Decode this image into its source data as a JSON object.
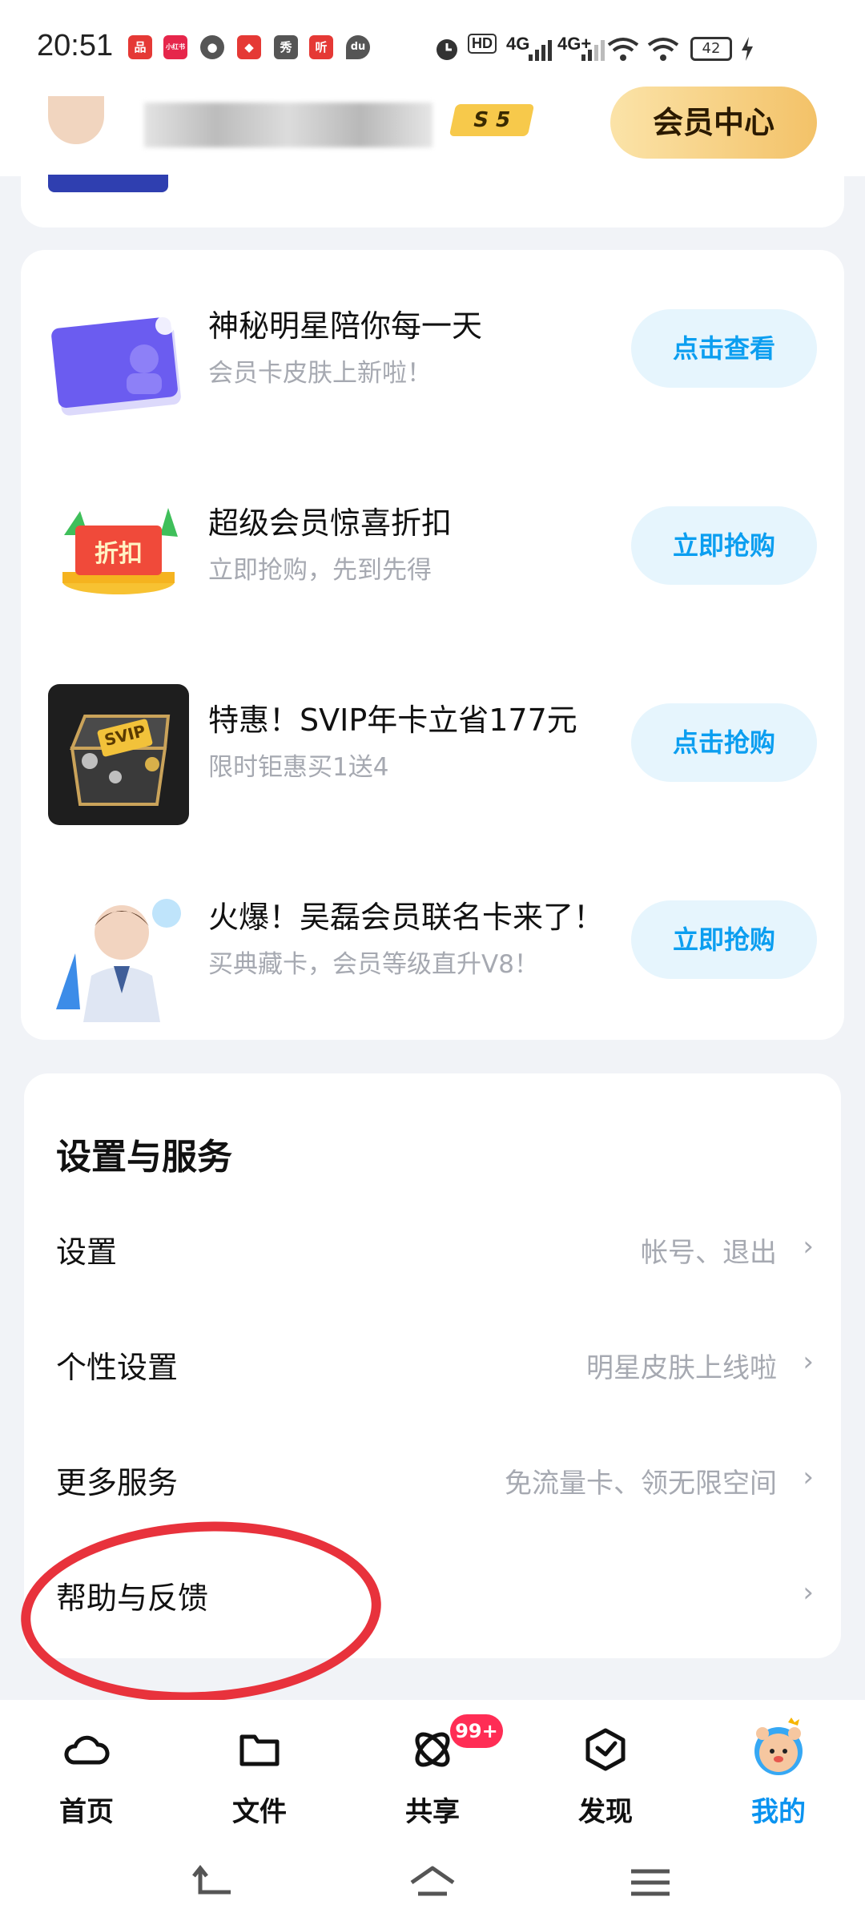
{
  "status_bar": {
    "time": "20:51",
    "app_icons": [
      {
        "name": "app-icon-1",
        "color": "#e53935",
        "glyph": "品"
      },
      {
        "name": "app-icon-2",
        "color": "#e6264b",
        "glyph": "小红书"
      },
      {
        "name": "chat-icon",
        "color": "#555555",
        "glyph": "●"
      },
      {
        "name": "app-icon-4",
        "color": "#e53935",
        "glyph": "◆"
      },
      {
        "name": "app-icon-xiu",
        "color": "#555555",
        "glyph": "秀"
      },
      {
        "name": "app-icon-ting",
        "color": "#e53935",
        "glyph": "听"
      },
      {
        "name": "map-pin-icon",
        "color": "#555555",
        "glyph": "du"
      }
    ],
    "network_1": "HD",
    "network_2": "4G",
    "network_3": "4G+",
    "battery": "42"
  },
  "header": {
    "level_badge": "S 5",
    "vip_center_label": "会员中心"
  },
  "promos": [
    {
      "title": "神秘明星陪你每一天",
      "subtitle": "会员卡皮肤上新啦！",
      "button": "点击查看",
      "thumb": "star-card"
    },
    {
      "title": "超级会员惊喜折扣",
      "subtitle": "立即抢购，先到先得",
      "button": "立即抢购",
      "thumb": "discount",
      "thumb_text": "折扣"
    },
    {
      "title": "特惠！SVIP年卡立省177元",
      "subtitle": "限时钜惠买1送4",
      "button": "点击抢购",
      "thumb": "treasure",
      "thumb_text": "SVIP"
    },
    {
      "title": "火爆！吴磊会员联名卡来了！",
      "subtitle": "买典藏卡，会员等级直升V8！",
      "button": "立即抢购",
      "thumb": "celebrity"
    }
  ],
  "settings": {
    "heading": "设置与服务",
    "rows": [
      {
        "label": "设置",
        "hint": "帐号、退出"
      },
      {
        "label": "个性设置",
        "hint": "明星皮肤上线啦"
      },
      {
        "label": "更多服务",
        "hint": "免流量卡、领无限空间"
      },
      {
        "label": "帮助与反馈",
        "hint": ""
      }
    ],
    "chevron": "›"
  },
  "tabbar": {
    "tabs": [
      {
        "label": "首页",
        "icon": "cloud-icon",
        "active": false
      },
      {
        "label": "文件",
        "icon": "folder-icon",
        "active": false
      },
      {
        "label": "共享",
        "icon": "share-icon",
        "active": false,
        "badge": "99+"
      },
      {
        "label": "发现",
        "icon": "discover-icon",
        "active": false
      },
      {
        "label": "我的",
        "icon": "mascot-icon",
        "active": true
      }
    ]
  },
  "colors": {
    "accent": "#0a93f0",
    "button_text": "#0b9ef0",
    "button_bg": "#e6f5fd",
    "vip_gold": "#f3c268",
    "annotation": "#e8323c",
    "badge": "#ff2d55"
  }
}
